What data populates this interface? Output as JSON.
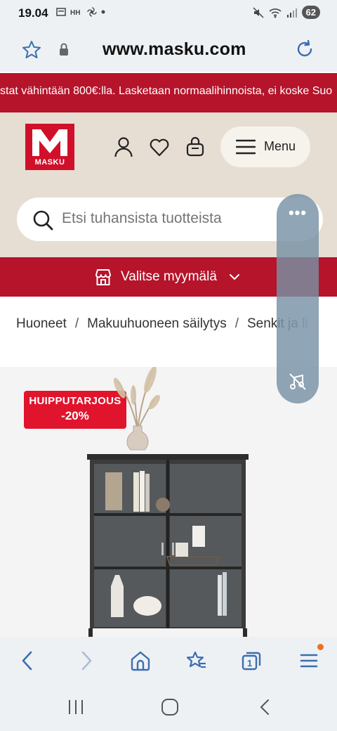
{
  "status_bar": {
    "time": "19.04",
    "battery": "62"
  },
  "browser": {
    "url": "www.masku.com"
  },
  "promo": {
    "text": "stat vähintään 800€:lla. Lasketaan normaalihinnoista, ei koske Suo"
  },
  "header": {
    "logo_text": "MASKU",
    "menu_label": "Menu",
    "search_placeholder": "Etsi tuhansista tuotteista"
  },
  "store": {
    "label": "Valitse myymälä"
  },
  "breadcrumb": {
    "items": [
      "Huoneet",
      "Makuuhuoneen säilytys",
      "Senkit ja li"
    ],
    "separator": "/"
  },
  "product": {
    "badge_title": "HUIPPUTARJOUS",
    "badge_discount": "-20%"
  },
  "floating_panel": {
    "dots": "•••"
  },
  "colors": {
    "brand_red": "#b5142b",
    "header_beige": "#e6ded2",
    "badge_red": "#e0142c",
    "chrome_bg": "#eef1f4"
  }
}
